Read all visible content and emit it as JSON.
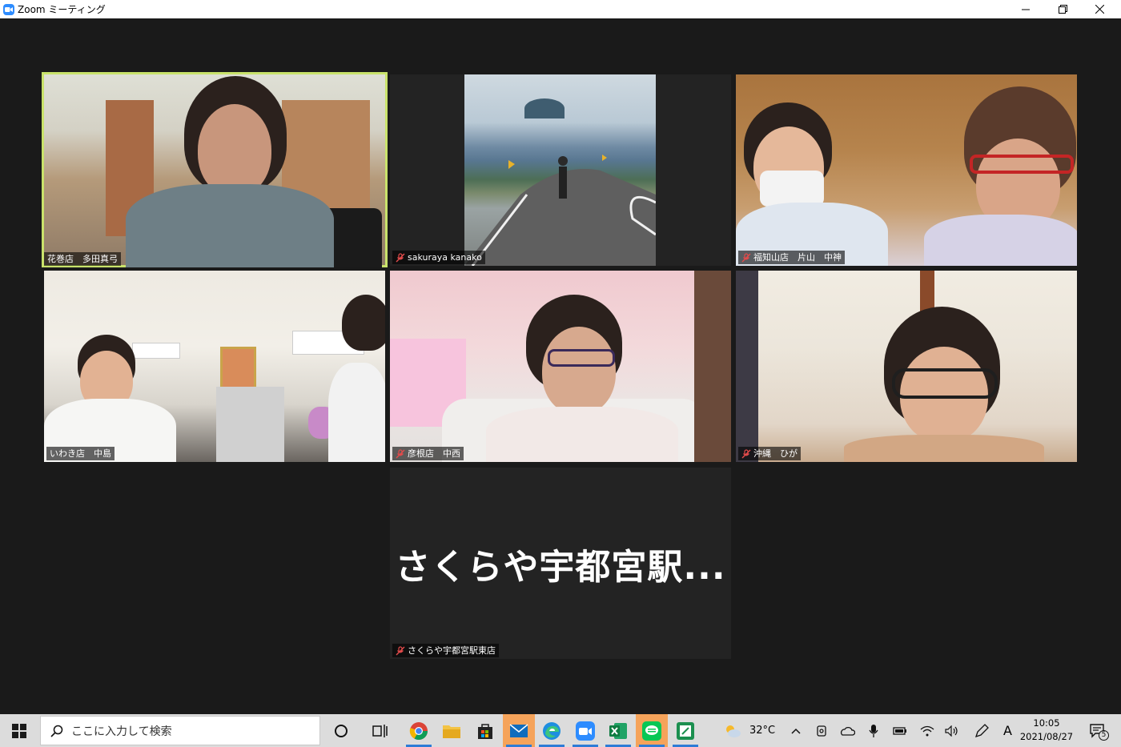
{
  "window": {
    "title": "Zoom ミーティング",
    "controls": {
      "minimize": "—",
      "maximize": "❐",
      "close": "✕"
    }
  },
  "participants": [
    {
      "name": "花巻店　多田真弓",
      "muted": false,
      "active_speaker": true
    },
    {
      "name": "sakuraya kanako",
      "muted": true,
      "active_speaker": false
    },
    {
      "name": "福知山店　片山　中神",
      "muted": true,
      "active_speaker": false
    },
    {
      "name": "いわき店　中島",
      "muted": false,
      "active_speaker": false
    },
    {
      "name": "彦根店　中西",
      "muted": true,
      "active_speaker": false
    },
    {
      "name": "沖縄　ひが",
      "muted": true,
      "active_speaker": false
    },
    {
      "name": "さくらや宇都宮駅東店",
      "muted": true,
      "active_speaker": false,
      "video_off": true,
      "display_text": "さくらや宇都宮駅..."
    }
  ],
  "taskbar": {
    "search_placeholder": "ここに入力して検索",
    "apps": [
      {
        "icon": "cortana-icon"
      },
      {
        "icon": "task-view-icon"
      },
      {
        "icon": "chrome-icon"
      },
      {
        "icon": "file-explorer-icon"
      },
      {
        "icon": "store-icon"
      },
      {
        "icon": "mail-icon"
      },
      {
        "icon": "edge-icon"
      },
      {
        "icon": "zoom-icon"
      },
      {
        "icon": "excel-icon"
      },
      {
        "icon": "line-icon"
      },
      {
        "icon": "spreadsheet-icon"
      }
    ],
    "weather": "32°C",
    "ime": "A",
    "time": "10:05",
    "date": "2021/08/27",
    "notification_count": "5"
  }
}
